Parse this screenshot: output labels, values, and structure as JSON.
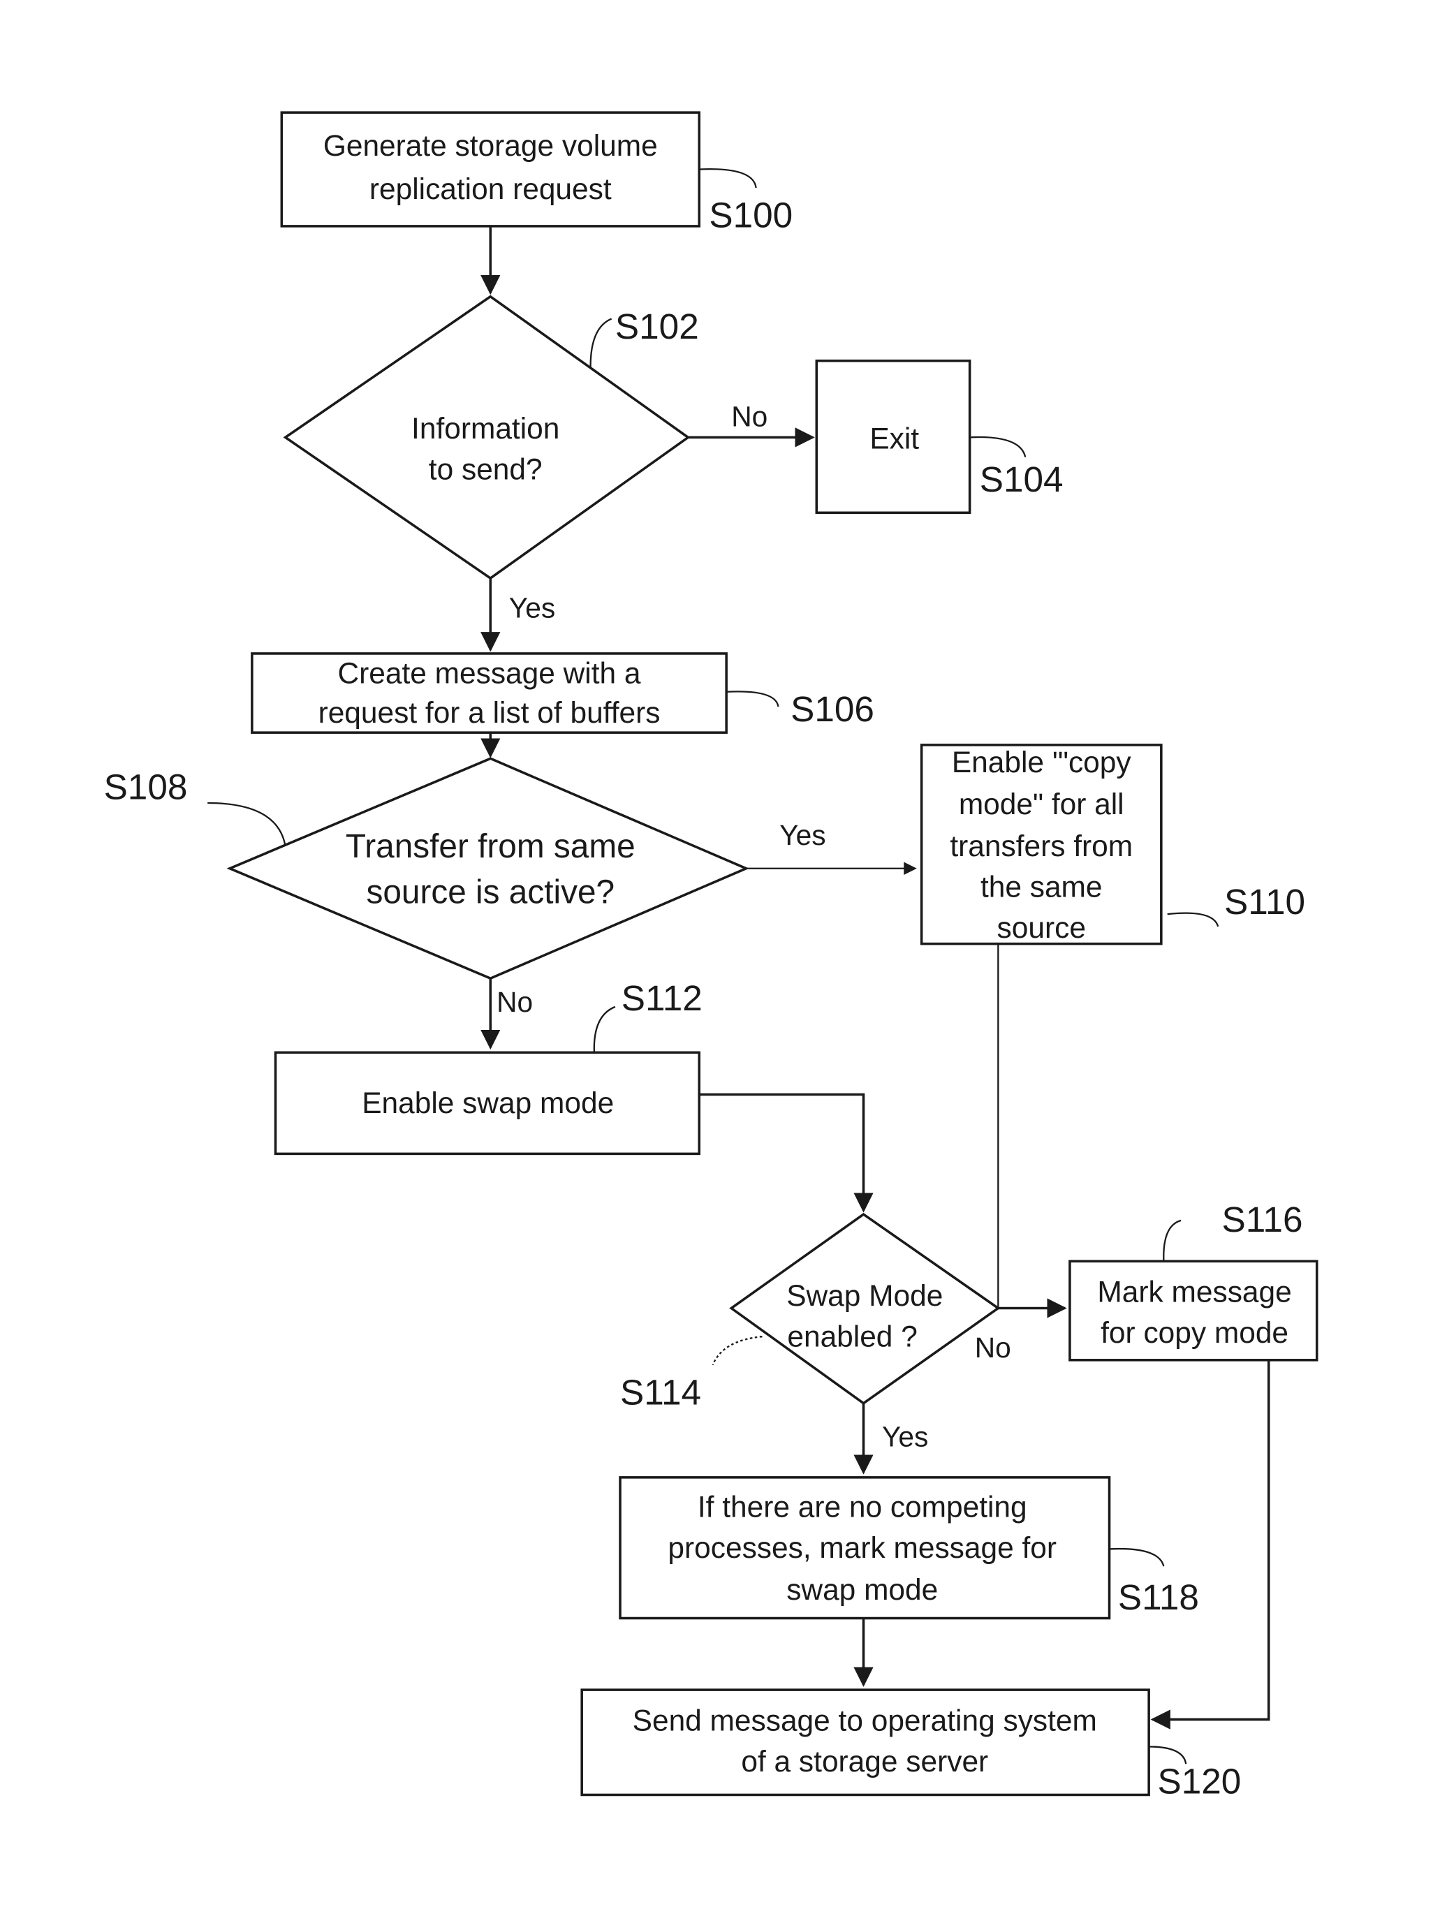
{
  "steps": {
    "s100": {
      "id": "S100",
      "lines": [
        "Generate storage volume",
        "replication request"
      ]
    },
    "s102": {
      "id": "S102",
      "lines": [
        "Information",
        "to send?"
      ]
    },
    "s104": {
      "id": "S104",
      "lines": [
        "Exit"
      ]
    },
    "s106": {
      "id": "S106",
      "lines": [
        "Create message with a",
        "request for a list of buffers"
      ]
    },
    "s108": {
      "id": "S108",
      "lines": [
        "Transfer from same",
        "source is active?"
      ]
    },
    "s110": {
      "id": "S110",
      "lines": [
        "Enable '\"copy",
        "mode\" for all",
        "transfers from",
        "the same",
        "source"
      ]
    },
    "s112": {
      "id": "S112",
      "lines": [
        "Enable  swap mode"
      ]
    },
    "s114": {
      "id": "S114",
      "lines": [
        "Swap Mode",
        "enabled ?"
      ]
    },
    "s116": {
      "id": "S116",
      "lines": [
        "Mark message",
        "for copy mode"
      ]
    },
    "s118": {
      "id": "S118",
      "lines": [
        "If there are no competing",
        "processes, mark message for",
        "swap mode"
      ]
    },
    "s120": {
      "id": "S120",
      "lines": [
        "Send message to operating system",
        "of a storage server"
      ]
    }
  },
  "edges": {
    "s102_no": "No",
    "s102_yes": "Yes",
    "s108_yes": "Yes",
    "s108_no": "No",
    "s114_no": "No",
    "s114_yes": "Yes"
  }
}
